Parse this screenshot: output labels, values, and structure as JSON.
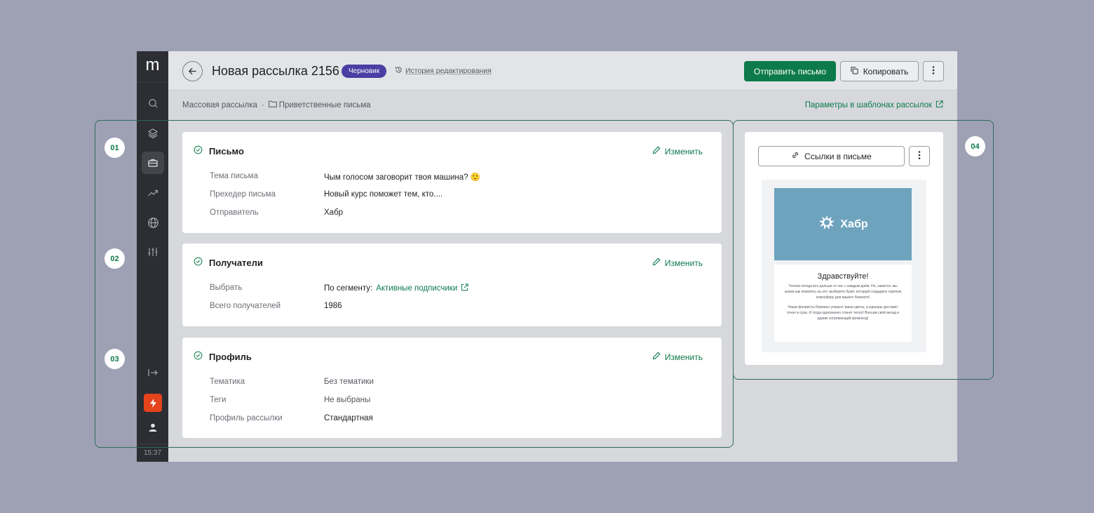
{
  "sidebar": {
    "logo": "m",
    "time": "15:37",
    "icons": [
      "search-icon",
      "layers-icon",
      "briefcase-icon",
      "trending-icon",
      "globe-icon",
      "sliders-icon",
      "expand-icon",
      "bolt-icon",
      "user-icon"
    ]
  },
  "header": {
    "title": "Новая рассылка 2156",
    "status": "Черновик",
    "history": "История редактирования",
    "send_label": "Отправить письмо",
    "copy_label": "Копировать"
  },
  "breadcrumb": {
    "root": "Массовая рассылка",
    "separator": "·",
    "folder": "Приветственные письма",
    "params_link": "Параметры в шаблонах рассылок"
  },
  "cards": {
    "letter": {
      "title": "Письмо",
      "edit": "Изменить",
      "rows": [
        {
          "key": "Тема письма",
          "value": "Чым голосом заговорит твоя машина? 🙂"
        },
        {
          "key": "Прехедер письма",
          "value": "Новый курс поможет тем, кто...."
        },
        {
          "key": "Отправитель",
          "value": "Хабр"
        }
      ]
    },
    "recipients": {
      "title": "Получатели",
      "edit": "Изменить",
      "select_key": "Выбрать",
      "select_prefix": "По сегменту:",
      "select_link": "Активные подписчики",
      "total_key": "Всего получателей",
      "total_value": "1986"
    },
    "profile": {
      "title": "Профиль",
      "edit": "Изменить",
      "rows": [
        {
          "key": "Тематика",
          "value": "Без тематики"
        },
        {
          "key": "Теги",
          "value": "Не выбраны"
        },
        {
          "key": "Профиль рассылки",
          "value": "Стандартная"
        }
      ]
    }
  },
  "preview": {
    "links_label": "Ссылки в письме",
    "brand": "Хабр",
    "greeting": "Здравствуйте!",
    "paragraph1": "Теплая погода все дальше от нас с каждым днём. Но, кажется, мы знаем как повлиять на это: выберите букет, который создадите горячую атмосферу для вашего близкого!",
    "paragraph2": "Наши флористы бережно упакуют ваши цветы, а курьеры доставят точно в срок. И тогда однозначно станет тепло! Вносим свой вклад и дарим согревающий промокод!"
  },
  "annotations": [
    "01",
    "02",
    "03",
    "04"
  ],
  "colors": {
    "accent": "#0d7a4b",
    "badge": "#4a3ea3",
    "sidebar": "#2c2e33",
    "bolt": "#e4431c",
    "banner": "#6ea3be"
  }
}
